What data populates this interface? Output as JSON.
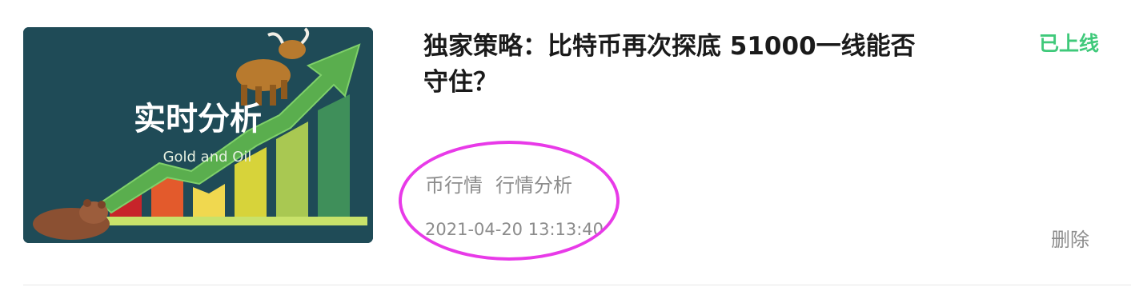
{
  "article": {
    "title": "独家策略：比特币再次探底 51000一线能否守住？",
    "status": "已上线",
    "tags": [
      "币行情",
      "行情分析"
    ],
    "timestamp": "2021-04-20 13:13:40",
    "delete_label": "删除",
    "thumbnail": {
      "caption_cn": "实时分析",
      "caption_en": "Gold and Oil"
    }
  },
  "colors": {
    "status": "#3fc97a",
    "annotation": "#e83ae8",
    "meta_text": "#8c8c8c",
    "title_text": "#1a1a1a"
  }
}
